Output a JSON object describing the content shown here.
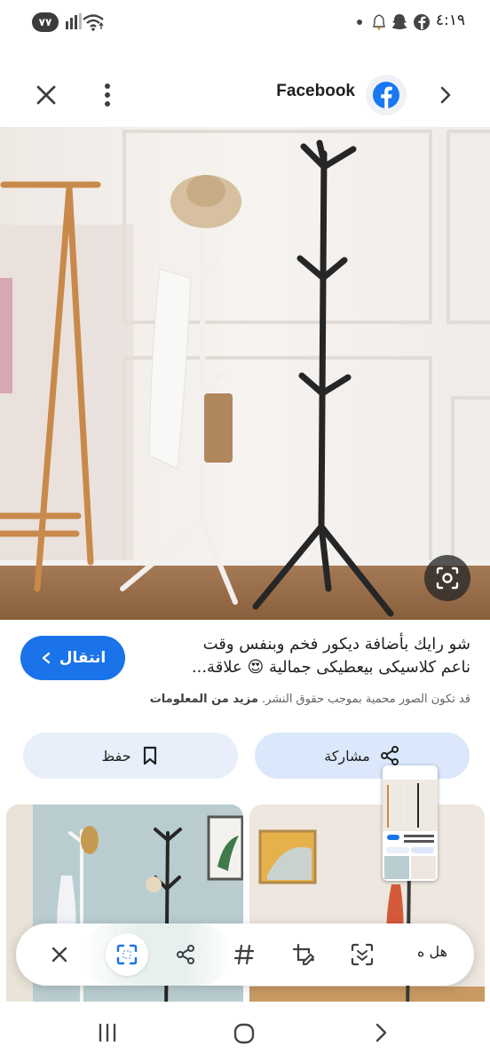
{
  "status_bar": {
    "battery_level": "٧٧",
    "time": "٤:١٩",
    "icons": [
      "notification-dot-icon",
      "notification-icon",
      "snapchat-icon",
      "facebook-icon",
      "alarm-icon",
      "wifi-icon",
      "signal-icon"
    ]
  },
  "header": {
    "title": "Facebook",
    "icons": [
      "close-icon",
      "more-vert-icon",
      "facebook-logo-icon",
      "chevron-right-icon"
    ]
  },
  "image": {
    "lens_icon": "camera-search-icon"
  },
  "caption": {
    "line1": "شو رايك بأضافة ديكور فخم وبنفس وقت",
    "line2": "ناعم كلاسيكى بيعطيكى جمالية 😍 علاقة...",
    "visit_label": "انتقال",
    "copyright_text": "قد تكون الصور محمية بموجب حقوق النشر.",
    "more_info_label": "مزيد من المعلومات"
  },
  "actions": {
    "share_label": "مشاركة",
    "save_label": "حفظ"
  },
  "toolbar": {
    "more_label": "هل ه",
    "icons": [
      "close-icon",
      "select-icon",
      "share-icon",
      "hashtag-icon",
      "edit-crop-icon",
      "scan-icon"
    ]
  },
  "navbar": {
    "icons": [
      "recents-icon",
      "home-icon",
      "back-icon"
    ]
  },
  "colors": {
    "accent": "#1a73e8",
    "pill": "#dbe7fb",
    "facebook": "#1877f2"
  }
}
